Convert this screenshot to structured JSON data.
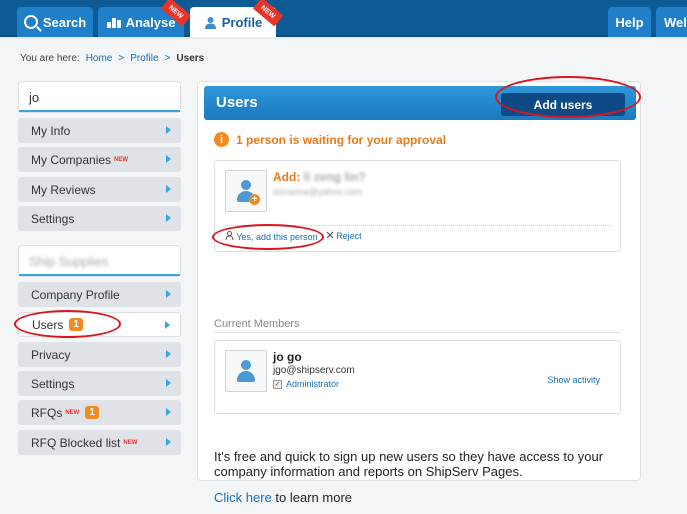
{
  "nav": {
    "tabs": [
      {
        "label": "Search",
        "ribbon": ""
      },
      {
        "label": "Analyse",
        "ribbon": "NEW"
      },
      {
        "label": "Profile",
        "ribbon": "NEW"
      },
      {
        "label": "Help",
        "ribbon": ""
      },
      {
        "label": "Wel",
        "ribbon": ""
      }
    ]
  },
  "breadcrumb": {
    "prefix": "You are here:",
    "items": [
      "Home",
      "Profile",
      "Users"
    ],
    "separator": ">"
  },
  "sidebar": {
    "box1_title": "jo",
    "group1": [
      {
        "label": "My Info",
        "new": ""
      },
      {
        "label": "My Companies",
        "new": "NEW"
      },
      {
        "label": "My Reviews",
        "new": ""
      },
      {
        "label": "Settings",
        "new": ""
      }
    ],
    "box2_title": "Ship Supplies",
    "group2": [
      {
        "label": "Company Profile",
        "new": "",
        "badge": ""
      },
      {
        "label": "Users",
        "new": "",
        "badge": "1"
      },
      {
        "label": "Privacy",
        "new": "",
        "badge": ""
      },
      {
        "label": "Settings",
        "new": "",
        "badge": ""
      },
      {
        "label": "RFQs",
        "new": "NEW",
        "badge": "1"
      },
      {
        "label": "RFQ Blocked list",
        "new": "NEW",
        "badge": ""
      }
    ]
  },
  "main": {
    "title": "Users",
    "add_button": "Add users",
    "notice_icon": "i",
    "notice": "1 person is waiting for your approval",
    "request": {
      "add_label": "Add:",
      "name": "li zeng lin?",
      "email": "lzlmarine@yahoo.com",
      "approve": "Yes, add this person",
      "reject": "Reject",
      "plus": "+"
    },
    "members_label": "Current Members",
    "member": {
      "name": "jo go",
      "email": "jgo@shipserv.com",
      "role": "Administrator",
      "check": "✓",
      "show_activity": "Show activity"
    },
    "footer_text": "It's free and quick to sign up new users so they have access to your company information and reports on ShipServ Pages.",
    "footer_link": "Click here",
    "footer_rest": " to learn more"
  },
  "colors": {
    "brand": "#0e5a95",
    "accent": "#1f7fc8",
    "highlight": "#d8161f",
    "orange": "#f28b1f"
  }
}
